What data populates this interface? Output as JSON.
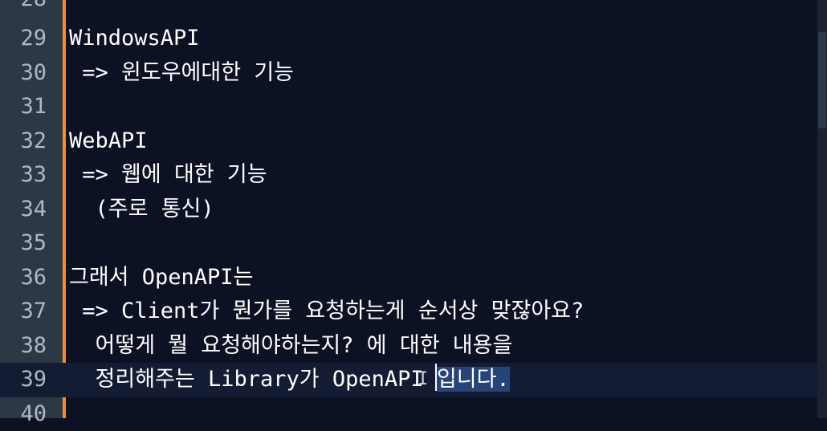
{
  "editor": {
    "lines": [
      {
        "n": "28",
        "text": ""
      },
      {
        "n": "29",
        "text": "WindowsAPI"
      },
      {
        "n": "30",
        "text": " => 윈도우에대한 기능"
      },
      {
        "n": "31",
        "text": ""
      },
      {
        "n": "32",
        "text": "WebAPI"
      },
      {
        "n": "33",
        "text": " => 웹에 대한 기능"
      },
      {
        "n": "34",
        "text": "  (주로 통신)"
      },
      {
        "n": "35",
        "text": ""
      },
      {
        "n": "36",
        "text": "그래서 OpenAPI는"
      },
      {
        "n": "37",
        "text": " => Client가 뭔가를 요청하는게 순서상 맞잖아요?"
      },
      {
        "n": "38",
        "text": "  어떻게 뭘 요청해야하는지? 에 대한 내용을"
      },
      {
        "n": "39",
        "text_before": "  정리해주는 Library가 OpenAPI ",
        "text_selected": "입니다.",
        "text": ""
      },
      {
        "n": "40",
        "text": ""
      }
    ]
  },
  "colors": {
    "background": "#0c1224",
    "gutter": "#2d3846",
    "gutter_marker": "#ff8c1a",
    "selection": "#26447a",
    "text": "#ffffff",
    "line_number": "#aeb7c6"
  },
  "icons": {
    "mouse_pointer": "i-beam-cursor-icon"
  }
}
